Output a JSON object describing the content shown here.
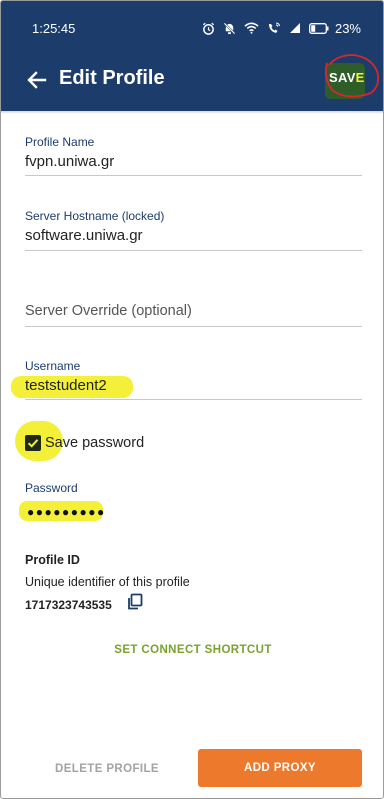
{
  "status_bar": {
    "time": "1:25:45",
    "battery": "23%",
    "icons": [
      "alarm-icon",
      "mute-icon",
      "wifi-icon",
      "wifi-call-icon",
      "signal-icon",
      "battery-icon"
    ]
  },
  "app_bar": {
    "title": "Edit Profile",
    "save_label": "SAVE",
    "color": "#1c3d6c"
  },
  "form": {
    "profile_name": {
      "label": "Profile Name",
      "value": "fvpn.uniwa.gr"
    },
    "server_hostname": {
      "label": "Server Hostname (locked)",
      "value": "software.uniwa.gr"
    },
    "server_override": {
      "placeholder": "Server Override (optional)"
    },
    "username": {
      "label": "Username",
      "value": "teststudent2"
    },
    "save_password": {
      "label": "Save password",
      "checked": true
    },
    "password": {
      "label": "Password",
      "masked": "●●●●●●●●●"
    }
  },
  "profile_id": {
    "title": "Profile ID",
    "description": "Unique identifier of this profile",
    "value": "1717323743535"
  },
  "actions": {
    "shortcut": "SET CONNECT SHORTCUT",
    "delete": "DELETE PROFILE",
    "add_proxy": "ADD PROXY",
    "accent": "#ed7a2c",
    "link_color": "#7aa22f"
  }
}
